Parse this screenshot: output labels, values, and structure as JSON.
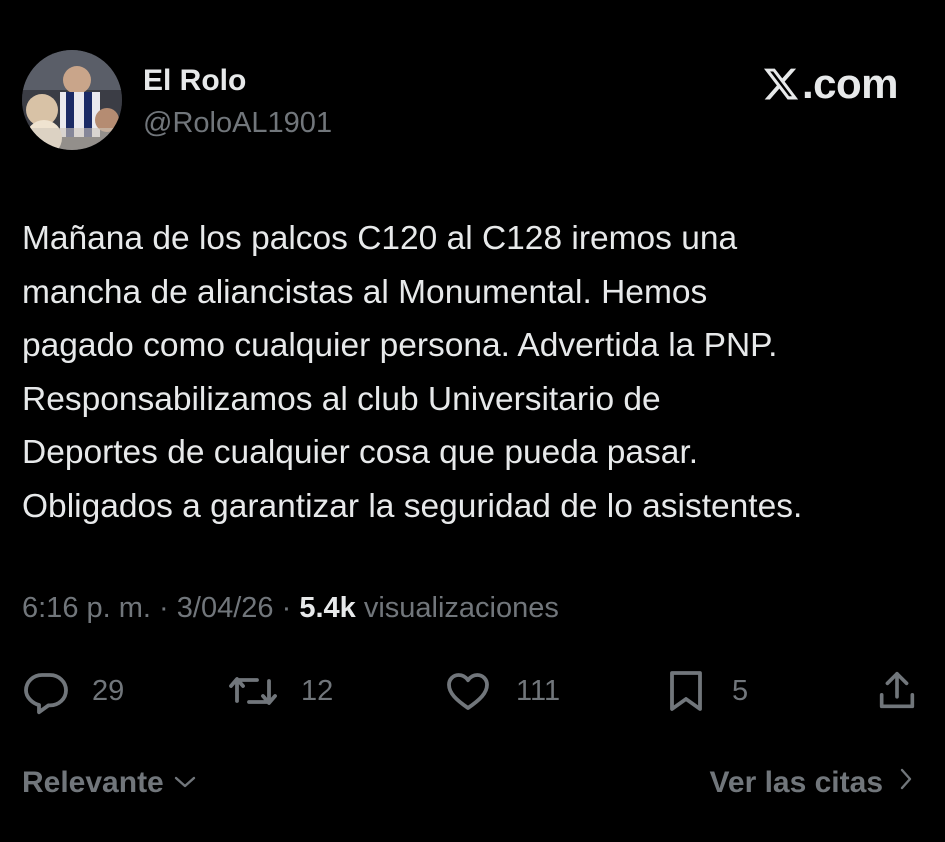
{
  "author": {
    "display_name": "El Rolo",
    "handle": "@RoloAL1901"
  },
  "brand": {
    "domain": ".com",
    "logo_icon": "x-logo-icon"
  },
  "tweet": {
    "lines": [
      "Mañana de los palcos C120 al C128 iremos una",
      "mancha de aliancistas al Monumental. Hemos",
      "pagado como cualquier persona. Advertida la PNP.",
      "Responsabilizamos al club Universitario de",
      "Deportes de cualquier cosa que pueda pasar.",
      "Obligados a garantizar la seguridad de lo asistentes."
    ]
  },
  "meta": {
    "time": "6:16 p. m.",
    "separator": "·",
    "date": "3/04/26",
    "views_count": "5.4k",
    "views_label": "visualizaciones"
  },
  "actions": {
    "replies": "29",
    "reposts": "12",
    "likes": "111",
    "bookmarks": "5"
  },
  "footer": {
    "sort_label": "Relevante",
    "quotes_label": "Ver las citas"
  },
  "colors": {
    "background": "#000000",
    "primary_text": "#e7e9ea",
    "secondary_text": "#71767b"
  }
}
